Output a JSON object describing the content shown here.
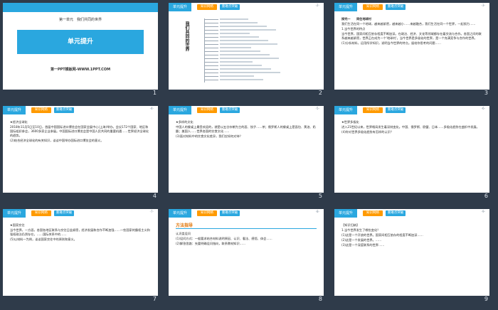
{
  "slides": [
    {
      "num": "1",
      "type": "cover",
      "unit_line": "第一单元　我们共同的世界",
      "title": "单元提升",
      "footer": "第一PPT模板网-WWW.1PPT.COM"
    },
    {
      "num": "2",
      "type": "mindmap",
      "header": "单元提升",
      "tab1": "知识网络",
      "tab2": "重难点突破",
      "pg": "-2-",
      "side_title": "我们共同的世界"
    },
    {
      "num": "3",
      "type": "text",
      "header": "单元提升",
      "tab1": "知识网络",
      "tab2": "重难点突破",
      "pg": "-3-",
      "title": "探究一　　同住地球村",
      "paras": [
        "我们生活在同一个地球，越来越紧密，越来越小……来越融合，我们生活在同一个世界，一起努力……",
        "1.当今世界的特点",
        "当今世界，国家间相互依存程度不断加深。在政治、经济、文化等领域都存在着交流与合作。各国之间的联系越来越紧密，世界正在成为一个'地球村'。当今世界是多极化的世界，是一个充满竞争与合作的世界。",
        "(1)分析材料，运用所学知识，说明当今世界的特点。留给你思考的问题……"
      ]
    },
    {
      "num": "4",
      "type": "text",
      "header": "单元提升",
      "tab1": "知识网络",
      "tab2": "重难点突破",
      "pg": "-4-",
      "paras": [
        "★经济全球化",
        "2018年11月5日至10日，首届中国国际进口博览会在国家会展中心(上海)举办。会议172个国家、地区和国际组织参会，3600多家企业参展。中国国际进口博览会是中国人民共同的重要机遇……世界经济全球化的趋势。",
        "(2)结合经济全球化的有关知识，谈谈中国举办国际进口博览会的意义。"
      ]
    },
    {
      "num": "5",
      "type": "text",
      "header": "单元提升",
      "tab1": "知识网络",
      "tab2": "重难点突破",
      "pg": "-5-",
      "paras": [
        "★多样的文化",
        "中国人的餐桌上最受欢迎的，就是以五谷杂粮为主的面、饺子……茶；俄罗斯人的餐桌上是面包、黄油、奶酪；美国人……世界各国的饮食文化……",
        "(3)面对材料中的饮食文化差异，我们应如何对待？"
      ]
    },
    {
      "num": "6",
      "type": "text",
      "header": "单元提升",
      "tab1": "知识网络",
      "tab2": "重难点突破",
      "pg": "-6-",
      "paras": [
        "★世界多极化",
        "进入21世纪以来，世界格局发生着深刻变化。中国、俄罗斯、欧盟、日本……多极化趋势在曲折中发展。",
        "(4)你对世界多极化趋势有怎样的认识？"
      ]
    },
    {
      "num": "7",
      "type": "text",
      "header": "单元提升",
      "tab1": "知识网络",
      "tab2": "重难点突破",
      "pg": "-7-",
      "paras": [
        "★国家交往",
        "当今世界，一方面，各国各地区联系与交往日益紧密，经济发展和合作不断加强……一些国家的霸权主义和强权政治仍然存在，……国际关系中的……",
        "(5)以材料一为例，谈谈国家交往中的原则和意义。"
      ]
    },
    {
      "num": "8",
      "type": "method",
      "header": "单元提升",
      "tab1": "知识网络",
      "tab2": "重难点突破",
      "pg": "-8-",
      "method_title": "方法指导",
      "paras": [
        "认识类设问",
        "(1)设问方式：一般要求结合材料说明原因、认识、看法、感悟、体会……",
        "(2)解答思路：先要明确设问指向，联系教材知识……"
      ]
    },
    {
      "num": "9",
      "type": "text",
      "header": "单元提升",
      "tab1": "知识网络",
      "tab2": "重难点突破",
      "pg": "-9-",
      "paras": [
        "【知识归纳】",
        "1.当今世界发生了哪些变化？",
        "(1)这是一个开放的世界。国家间相互依存的程度不断加深……",
        "(2)这是一个发展的世界。……",
        "(3)这是一个深度联系的世界……"
      ]
    }
  ]
}
